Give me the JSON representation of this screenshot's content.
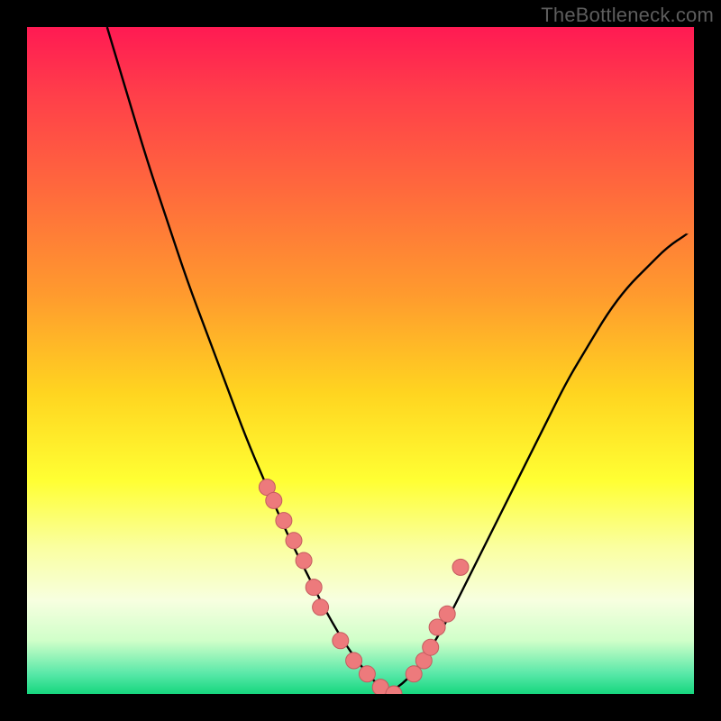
{
  "attribution": "TheBottleneck.com",
  "colors": {
    "frame_bg": "#000000",
    "curve_stroke": "#000000",
    "marker_fill": "#ed7a7c",
    "marker_stroke": "#c45b5f"
  },
  "chart_data": {
    "type": "line",
    "title": "",
    "xlabel": "",
    "ylabel": "",
    "xlim": [
      0,
      100
    ],
    "ylim": [
      0,
      100
    ],
    "grid": false,
    "legend": false,
    "series": [
      {
        "name": "bottleneck-curve",
        "x": [
          12,
          15,
          18,
          21,
          24,
          27,
          30,
          33,
          36,
          39,
          42,
          45,
          48,
          51,
          54,
          57,
          60,
          63,
          66,
          69,
          72,
          75,
          78,
          81,
          84,
          87,
          90,
          93,
          96,
          99
        ],
        "y": [
          100,
          90,
          80,
          71,
          62,
          54,
          46,
          38,
          31,
          24,
          18,
          12,
          7,
          3,
          0,
          2,
          6,
          11,
          17,
          23,
          29,
          35,
          41,
          47,
          52,
          57,
          61,
          64,
          67,
          69
        ]
      },
      {
        "name": "measured-points",
        "x": [
          36,
          37,
          38.5,
          40,
          41.5,
          43,
          44,
          47,
          49,
          51,
          53,
          55,
          58,
          59.5,
          60.5,
          61.5,
          63,
          65
        ],
        "y": [
          31,
          29,
          26,
          23,
          20,
          16,
          13,
          8,
          5,
          3,
          1,
          0,
          3,
          5,
          7,
          10,
          12,
          19
        ]
      }
    ]
  }
}
